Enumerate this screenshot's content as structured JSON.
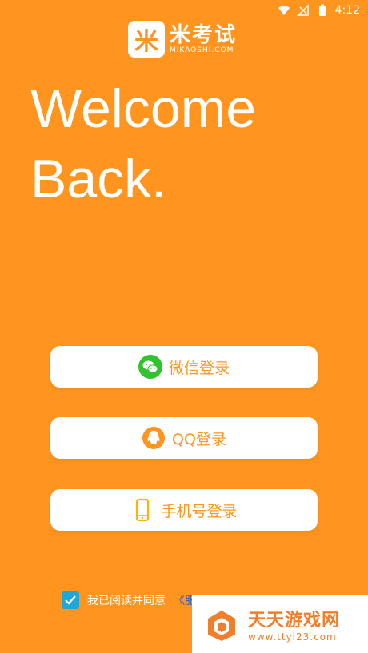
{
  "status_bar": {
    "time": "4:12"
  },
  "logo": {
    "mark": "米",
    "name": "米考试",
    "sub": "MIKAOSHI.COM"
  },
  "welcome": {
    "line1": "Welcome",
    "line2": "Back."
  },
  "buttons": {
    "wechat": "微信登录",
    "qq": "QQ登录",
    "phone": "手机号登录"
  },
  "agreement": {
    "text": "我已阅读并同意",
    "link": "《服"
  },
  "watermark": {
    "title": "天天游戏网",
    "url": "www.ttyl23.com"
  },
  "colors": {
    "brand": "#FF951F",
    "wechat": "#32C230",
    "checkbox": "#1EA7D8"
  }
}
